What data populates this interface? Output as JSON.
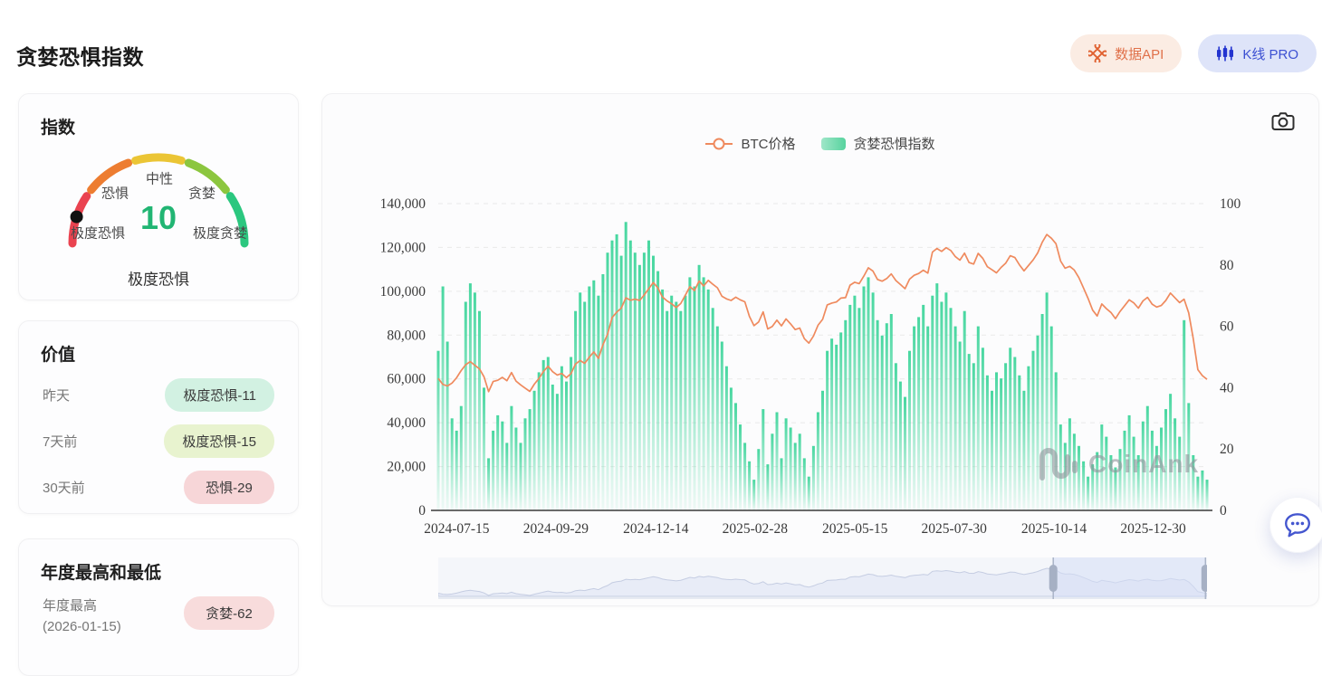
{
  "page": {
    "title": "贪婪恐惧指数"
  },
  "header": {
    "api_button": {
      "label": "数据API",
      "color": "#e0714a"
    },
    "kline_button": {
      "label": "K线 PRO",
      "color": "#3c50d2"
    }
  },
  "gauge_card": {
    "title": "指数",
    "value": 10,
    "status": "极度恐惧",
    "value_color": "#21b573",
    "segments": [
      {
        "label": "极度恐惧",
        "color": "#ea4350"
      },
      {
        "label": "恐惧",
        "color": "#ed7d31"
      },
      {
        "label": "中性",
        "color": "#ebc535"
      },
      {
        "label": "贪婪",
        "color": "#8cc63f"
      },
      {
        "label": "极度贪婪",
        "color": "#2bc77f"
      }
    ]
  },
  "value_card": {
    "title": "价值",
    "rows": [
      {
        "label": "昨天",
        "badge": "极度恐惧-11",
        "badge_bg": "#d2f1e2"
      },
      {
        "label": "7天前",
        "badge": "极度恐惧-15",
        "badge_bg": "#e8f3cf"
      },
      {
        "label": "30天前",
        "badge": "恐惧-29",
        "badge_bg": "#f7d6d8"
      }
    ]
  },
  "annual_card": {
    "title": "年度最高和最低",
    "rows": [
      {
        "label": "年度最高",
        "sublabel": "(2026-01-15)",
        "badge": "贪婪-62",
        "badge_bg": "#f8dcdc"
      }
    ]
  },
  "watermark": {
    "text": "CoinAnk"
  },
  "chart_data": {
    "type": "line+bar",
    "legend": [
      {
        "label": "BTC价格",
        "type": "line",
        "color": "#ef8a5e"
      },
      {
        "label": "贪婪恐惧指数",
        "type": "bar",
        "color": "#3ed59b"
      }
    ],
    "y_left": {
      "axis": "BTC price (USD)",
      "min": 0,
      "max": 140000,
      "ticks": [
        {
          "v": 0,
          "label": "0"
        },
        {
          "v": 20000,
          "label": "20,000"
        },
        {
          "v": 40000,
          "label": "40,000"
        },
        {
          "v": 60000,
          "label": "60,000"
        },
        {
          "v": 80000,
          "label": "80,000"
        },
        {
          "v": 100000,
          "label": "100,000"
        },
        {
          "v": 120000,
          "label": "120,000"
        },
        {
          "v": 140000,
          "label": "140,000"
        }
      ]
    },
    "y_right": {
      "axis": "Fear & Greed index",
      "min": 0,
      "max": 100,
      "ticks": [
        {
          "v": 0,
          "label": "0"
        },
        {
          "v": 20,
          "label": "20"
        },
        {
          "v": 40,
          "label": "40"
        },
        {
          "v": 60,
          "label": "60"
        },
        {
          "v": 80,
          "label": "80"
        },
        {
          "v": 100,
          "label": "100"
        }
      ]
    },
    "x_ticks": [
      {
        "label": "2024-07-15",
        "f": 0.024
      },
      {
        "label": "2024-09-29",
        "f": 0.153
      },
      {
        "label": "2024-12-14",
        "f": 0.283
      },
      {
        "label": "2025-02-28",
        "f": 0.412
      },
      {
        "label": "2025-05-15",
        "f": 0.542
      },
      {
        "label": "2025-07-30",
        "f": 0.671
      },
      {
        "label": "2025-10-14",
        "f": 0.801
      },
      {
        "label": "2025-12-30",
        "f": 0.93
      }
    ],
    "x_range": [
      "2024-07-01",
      "2026-02-06"
    ],
    "grid": "dashed horizontal at left-axis ticks",
    "series": [
      {
        "name": "BTC价格",
        "axis": "left",
        "color": "#ef8a5e",
        "values": [
          60200,
          57500,
          56800,
          58100,
          60500,
          63800,
          66500,
          67900,
          66200,
          64600,
          61000,
          54200,
          58800,
          59400,
          60700,
          59200,
          62900,
          59000,
          57300,
          55800,
          54300,
          57600,
          60200,
          63400,
          65800,
          63300,
          61800,
          62500,
          60600,
          62400,
          66800,
          68400,
          67100,
          69900,
          72300,
          69400,
          75600,
          80400,
          88000,
          90500,
          92300,
          97000,
          95900,
          96400,
          95800,
          98300,
          101200,
          104000,
          101500,
          97400,
          95600,
          94300,
          92600,
          94400,
          98200,
          102100,
          100300,
          104700,
          102400,
          105000,
          103200,
          101600,
          97700,
          96500,
          95800,
          97300,
          96100,
          95200,
          88600,
          84300,
          86000,
          90600,
          82800,
          83900,
          86800,
          84200,
          87400,
          85100,
          82500,
          83200,
          78400,
          76300,
          79600,
          84500,
          87200,
          93800,
          94600,
          95100,
          96900,
          97100,
          102800,
          104100,
          103500,
          106900,
          110700,
          109200,
          105400,
          104600,
          105800,
          107900,
          104900,
          103100,
          101200,
          105500,
          107300,
          108100,
          109600,
          108300,
          117900,
          119500,
          118200,
          119900,
          118600,
          115800,
          114200,
          117400,
          113100,
          112400,
          117300,
          115000,
          111200,
          109800,
          108400,
          110900,
          112800,
          116200,
          115400,
          112100,
          109300,
          111800,
          114300,
          117500,
          122400,
          125900,
          124200,
          121700,
          113800,
          110500,
          111400,
          109700,
          106200,
          101500,
          96800,
          91400,
          88700,
          94200,
          92100,
          90300,
          87500,
          90800,
          93400,
          96100,
          94700,
          92300,
          95600,
          97200,
          94100,
          92800,
          93500,
          95800,
          99200,
          97000,
          94800,
          96400,
          90100,
          78400,
          64200,
          61500,
          59800
        ]
      },
      {
        "name": "贪婪恐惧指数",
        "axis": "right",
        "color": "#3ed59b",
        "values": [
          52,
          73,
          55,
          30,
          26,
          34,
          68,
          74,
          71,
          65,
          40,
          17,
          26,
          31,
          29,
          22,
          34,
          27,
          22,
          30,
          33,
          39,
          45,
          49,
          50,
          41,
          38,
          47,
          42,
          50,
          65,
          71,
          68,
          73,
          75,
          70,
          77,
          84,
          88,
          90,
          83,
          94,
          88,
          84,
          80,
          84,
          88,
          83,
          78,
          72,
          65,
          70,
          68,
          65,
          70,
          76,
          73,
          80,
          76,
          72,
          66,
          60,
          55,
          47,
          40,
          35,
          28,
          22,
          16,
          10,
          20,
          33,
          15,
          25,
          32,
          17,
          30,
          27,
          22,
          25,
          17,
          11,
          21,
          32,
          39,
          52,
          56,
          54,
          58,
          62,
          67,
          70,
          66,
          73,
          76,
          71,
          62,
          57,
          61,
          64,
          48,
          42,
          37,
          52,
          60,
          63,
          67,
          60,
          70,
          74,
          68,
          71,
          66,
          60,
          55,
          65,
          51,
          48,
          60,
          53,
          44,
          39,
          45,
          43,
          48,
          53,
          50,
          44,
          39,
          47,
          52,
          57,
          64,
          71,
          60,
          45,
          28,
          22,
          30,
          25,
          21,
          16,
          11,
          15,
          19,
          28,
          24,
          18,
          14,
          20,
          26,
          31,
          24,
          18,
          29,
          34,
          26,
          21,
          27,
          33,
          38,
          30,
          24,
          62,
          35,
          18,
          11,
          13,
          10
        ]
      }
    ],
    "brush": {
      "start_fraction": 0.8,
      "end_fraction": 0.998
    }
  }
}
